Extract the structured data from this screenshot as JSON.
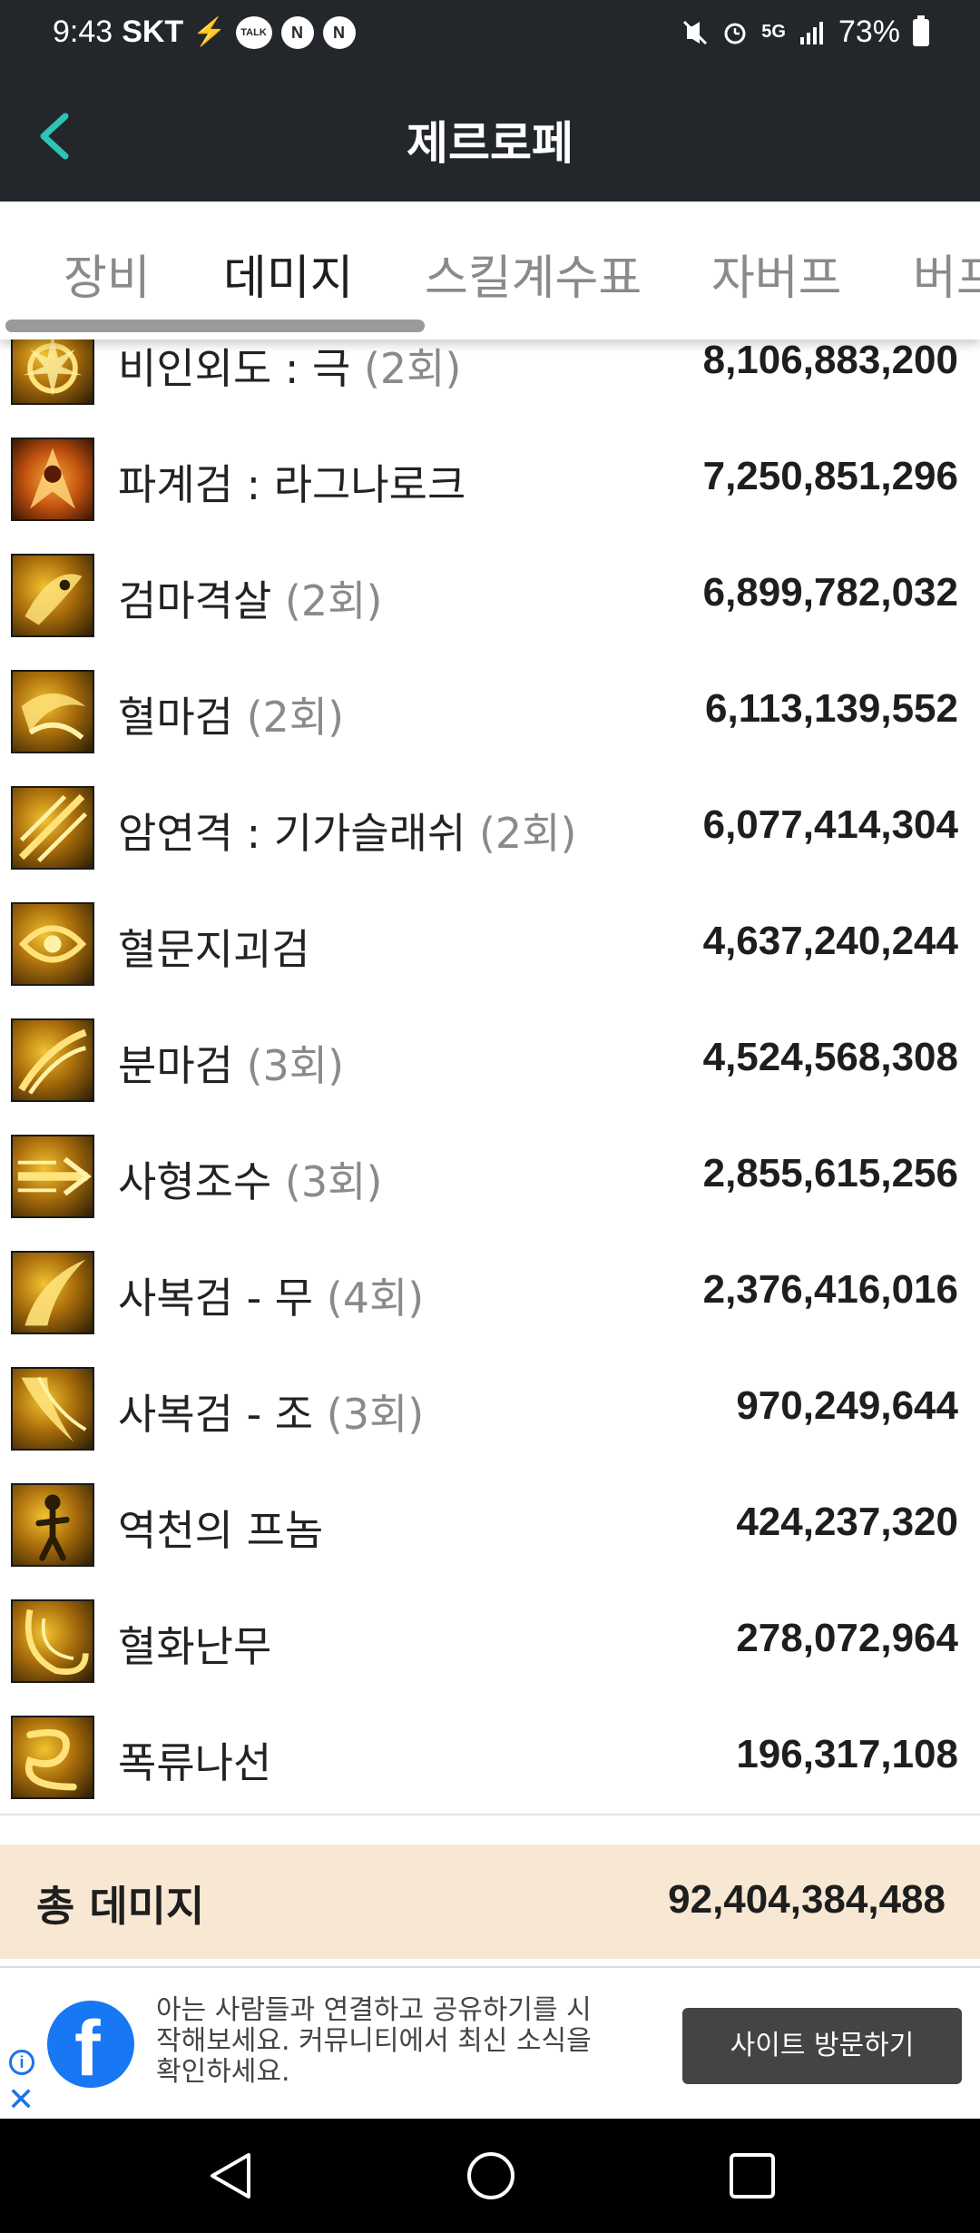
{
  "status_bar": {
    "time": "9:43",
    "carrier": "SKT",
    "network": "5G",
    "battery": "73%"
  },
  "app_bar": {
    "title": "제르로페"
  },
  "tabs": [
    {
      "label": "장비",
      "active": false
    },
    {
      "label": "데미지",
      "active": true
    },
    {
      "label": "스킬계수표",
      "active": false
    },
    {
      "label": "자버프",
      "active": false
    },
    {
      "label": "버프",
      "active": false
    }
  ],
  "skills": [
    {
      "name": "비인외도 : 극",
      "count": "(2회)",
      "damage": "8,106,883,200"
    },
    {
      "name": "파계검 : 라그나로크",
      "count": "",
      "damage": "7,250,851,296"
    },
    {
      "name": "검마격살",
      "count": "(2회)",
      "damage": "6,899,782,032"
    },
    {
      "name": "혈마검",
      "count": "(2회)",
      "damage": "6,113,139,552"
    },
    {
      "name": "암연격 : 기가슬래쉬",
      "count": "(2회)",
      "damage": "6,077,414,304"
    },
    {
      "name": "혈문지괴검",
      "count": "",
      "damage": "4,637,240,244"
    },
    {
      "name": "분마검",
      "count": "(3회)",
      "damage": "4,524,568,308"
    },
    {
      "name": "사형조수",
      "count": "(3회)",
      "damage": "2,855,615,256"
    },
    {
      "name": "사복검 - 무",
      "count": "(4회)",
      "damage": "2,376,416,016"
    },
    {
      "name": "사복검 - 조",
      "count": "(3회)",
      "damage": "970,249,644"
    },
    {
      "name": "역천의 프놈",
      "count": "",
      "damage": "424,237,320"
    },
    {
      "name": "혈화난무",
      "count": "",
      "damage": "278,072,964"
    },
    {
      "name": "폭류나선",
      "count": "",
      "damage": "196,317,108"
    }
  ],
  "total": {
    "label": "총 데미지",
    "value": "92,404,384,488"
  },
  "ad": {
    "text": "아는 사람들과 연결하고 공유하기를 시작해보세요. 커뮤니티에서 최신 소식을 확인하세요.",
    "button": "사이트 방문하기",
    "logo": "facebook-logo"
  },
  "colors": {
    "app_bar": "#23272b",
    "accent": "#2ec4b6",
    "total_bg": "#f8e8d3",
    "icon_gold": "#f2c330"
  }
}
